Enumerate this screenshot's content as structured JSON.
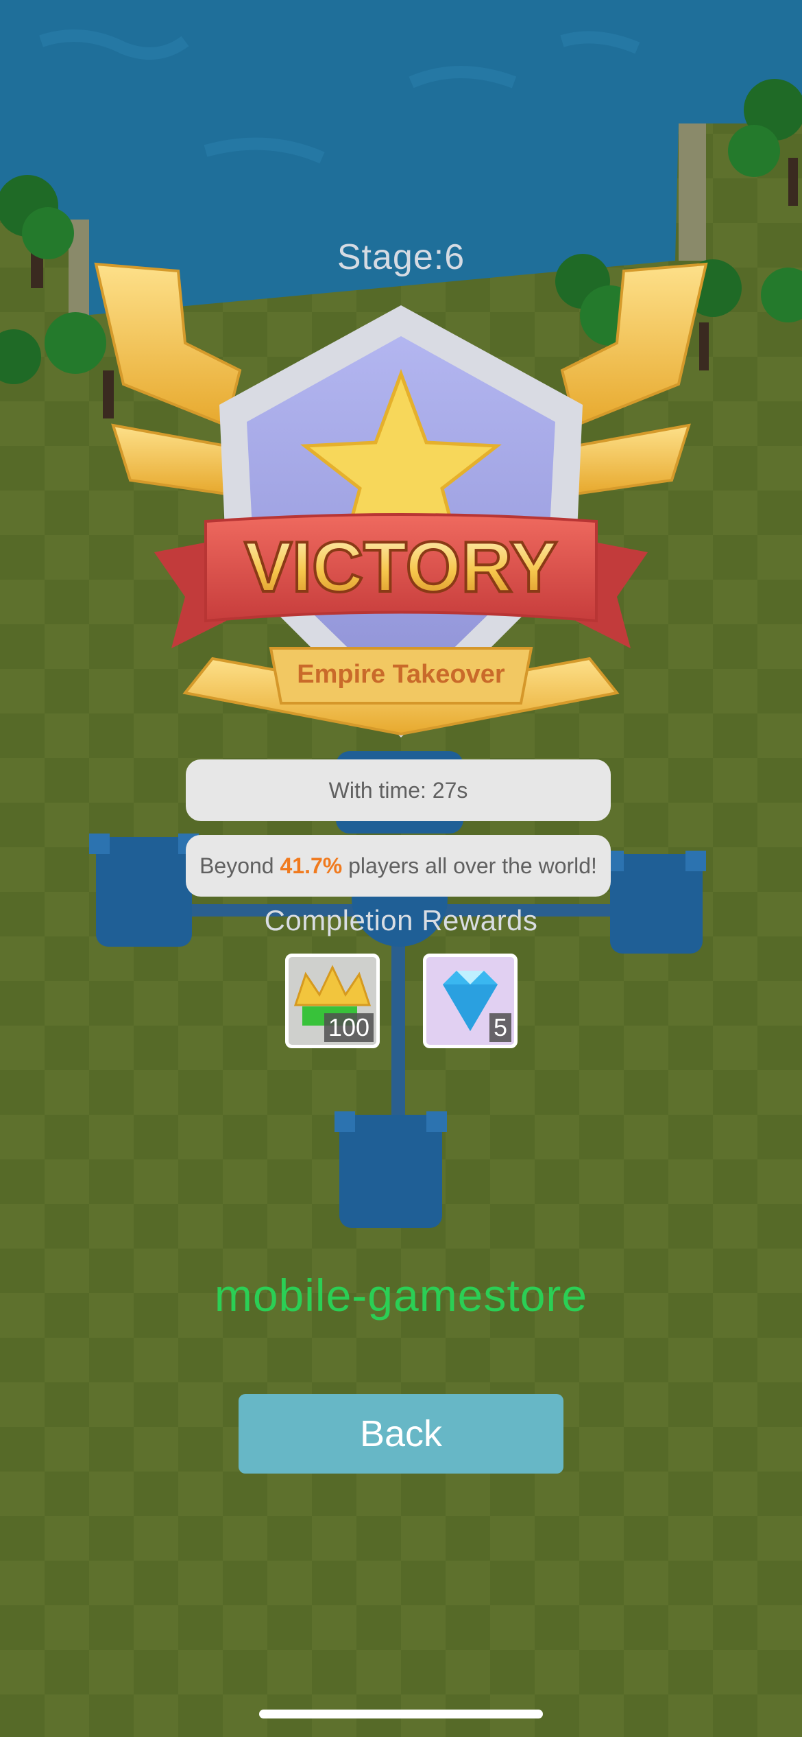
{
  "stage": {
    "label": "Stage:6"
  },
  "banner": {
    "title": "VICTORY",
    "subtitle": "Empire Takeover"
  },
  "stats": {
    "time_text": "With time: 27s",
    "beyond_prefix": "Beyond ",
    "beyond_percent": "41.7%",
    "beyond_suffix": " players all over the world!"
  },
  "rewards": {
    "title": "Completion Rewards",
    "items": [
      {
        "icon": "gold-crown-icon",
        "count": "100"
      },
      {
        "icon": "diamond-icon",
        "count": "5"
      }
    ]
  },
  "watermark": {
    "text": "mobile-gamestore"
  },
  "back_button": {
    "label": "Back"
  },
  "colors": {
    "water": "#1f6f9a",
    "grass": "#5b6e2b",
    "castle": "#1f5f96",
    "ribbon": "#e2504c",
    "gold": "#f0c24a",
    "shield": "#a5a8e6",
    "accent_percent": "#f07a1e",
    "watermark": "#2bcf55",
    "button": "#67b7c6"
  }
}
